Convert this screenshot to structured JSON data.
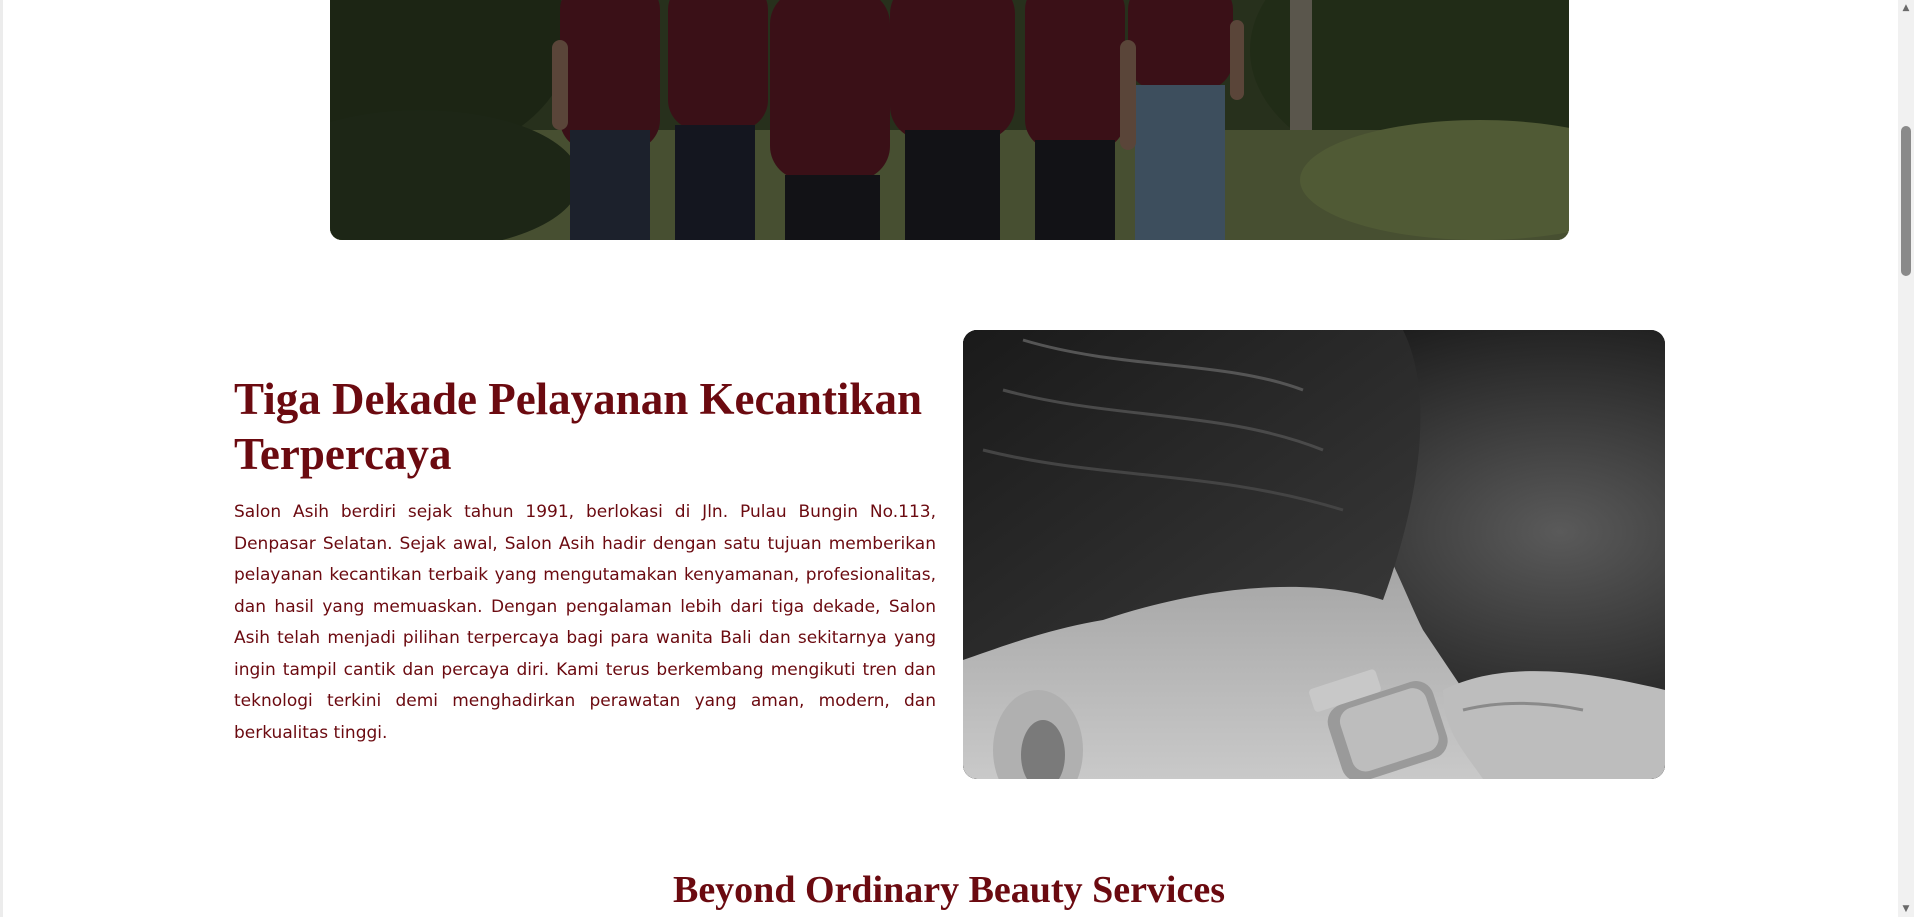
{
  "team_photo": {
    "icon": "team-photo-image"
  },
  "about": {
    "title": "Tiga Dekade Pelayanan Kecantikan Terpercaya",
    "body": "Salon Asih berdiri sejak tahun 1991, berlokasi di Jln. Pulau Bungin No.113, Denpasar Selatan. Sejak awal, Salon Asih hadir dengan satu tujuan memberikan pelayanan kecantikan terbaik yang mengutamakan kenyamanan, profesionalitas, dan hasil yang memuaskan. Dengan pengalaman lebih dari tiga dekade, Salon Asih telah menjadi pilihan terpercaya bagi para wanita Bali dan sekitarnya yang ingin tampil cantik dan percaya diri. Kami terus berkembang mengikuti tren dan teknologi terkini demi menghadirkan perawatan yang aman, modern, dan berkualitas tinggi.",
    "image_icon": "haircut-clipper-photo"
  },
  "services": {
    "heading": "Beyond Ordinary Beauty Services"
  },
  "scrollbar": {
    "up_glyph": "▲",
    "down_glyph": "▼"
  },
  "colors": {
    "accent": "#6b0a10",
    "background": "#ffffff"
  }
}
